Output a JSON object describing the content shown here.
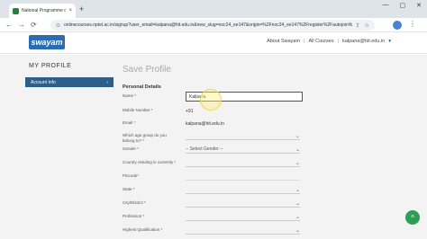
{
  "browser": {
    "tab_title": "National Programme on Techn",
    "tab_close": "×",
    "new_tab": "+",
    "url": "onlinecourses.nptel.ac.in/signup?user_email=kalpana@hit.edu.in&new_slug=noc24_ee147&origin=%2Fnoc24_ee147%2Fregister%2Fautojoin%3Dyes%2...",
    "back": "←",
    "forward": "→",
    "reload": "⟳",
    "lock": "🔒",
    "window_minimize": "—",
    "window_maximize": "▢",
    "window_close": "✕",
    "menu": "⋮"
  },
  "site": {
    "logo_text": "swayam",
    "links": [
      "About Swayam",
      "All Courses",
      "kalpana@hit.edu.in"
    ],
    "separator": "|",
    "dropdown_caret": "▾"
  },
  "sidebar": {
    "heading": "MY PROFILE",
    "items": [
      {
        "label": "Account Info",
        "chevron": "›"
      }
    ]
  },
  "form": {
    "page_title": "Save Profile",
    "section": "Personal Details",
    "fields": {
      "name": {
        "label": "Name *",
        "value": "Kalpana"
      },
      "mobile": {
        "label": "Mobile Number *",
        "value": "+91"
      },
      "email": {
        "label": "Email *",
        "value": "kalpana@hit.edu.in"
      },
      "age_group": {
        "label": "Which age group do you belong to? *",
        "value": ""
      },
      "gender": {
        "label": "Gender *",
        "value": "-- Select Gender --"
      },
      "country": {
        "label": "Country residing in currently *",
        "value": ""
      },
      "pincode": {
        "label": "Pincode*",
        "value": ""
      },
      "state": {
        "label": "State *",
        "value": ""
      },
      "city": {
        "label": "City/District *",
        "value": ""
      },
      "profession": {
        "label": "Profession *",
        "value": ""
      },
      "qualification": {
        "label": "Highest Qualification *",
        "value": ""
      }
    },
    "chevron": "⌄"
  },
  "scroll_top": "^",
  "colors": {
    "accent": "#2c5f8a",
    "logo": "#2b6cb0",
    "scroll_button": "#2e9e54"
  }
}
